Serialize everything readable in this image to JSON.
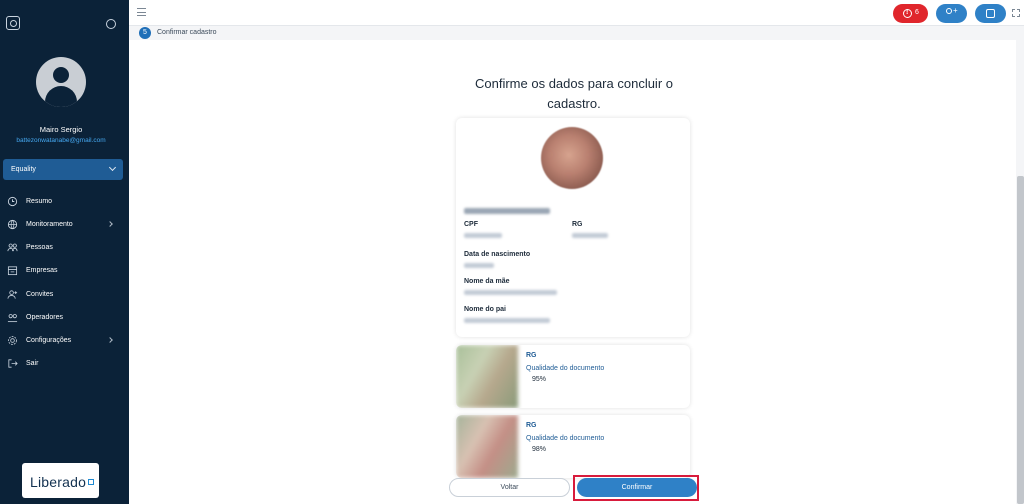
{
  "sidebar": {
    "user_name": "Mairo Sergio",
    "user_email": "battezonwatanabe@gmail.com",
    "company": "Equality",
    "items": [
      {
        "label": "Resumo",
        "icon": "clock-icon"
      },
      {
        "label": "Monitoramento",
        "icon": "globe-icon"
      },
      {
        "label": "Pessoas",
        "icon": "people-icon"
      },
      {
        "label": "Empresas",
        "icon": "building-icon"
      },
      {
        "label": "Convites",
        "icon": "add-user-icon"
      },
      {
        "label": "Operadores",
        "icon": "operators-icon"
      },
      {
        "label": "Configurações",
        "icon": "gear-icon"
      },
      {
        "label": "Sair",
        "icon": "logout-icon"
      }
    ],
    "logo_text": "Liberado"
  },
  "topbar": {
    "alert_count": "6"
  },
  "stepper": {
    "step_number": "5",
    "step_label": "Confirmar cadastro"
  },
  "main": {
    "title": "Confirme os dados para concluir o cadastro.",
    "fields": {
      "cpf_label": "CPF",
      "rg_label": "RG",
      "birth_label": "Data de nascimento",
      "mother_label": "Nome da mãe",
      "father_label": "Nome do pai"
    },
    "documents": [
      {
        "type": "RG",
        "quality_label": "Qualidade do documento",
        "quality": "95%"
      },
      {
        "type": "RG",
        "quality_label": "Qualidade do documento",
        "quality": "98%"
      }
    ],
    "buttons": {
      "back": "Voltar",
      "confirm": "Confirmar"
    }
  },
  "colors": {
    "sidebar_bg": "#0b2238",
    "accent": "#2f81c7",
    "alert": "#e0262c",
    "highlight": "#d81b3c"
  }
}
